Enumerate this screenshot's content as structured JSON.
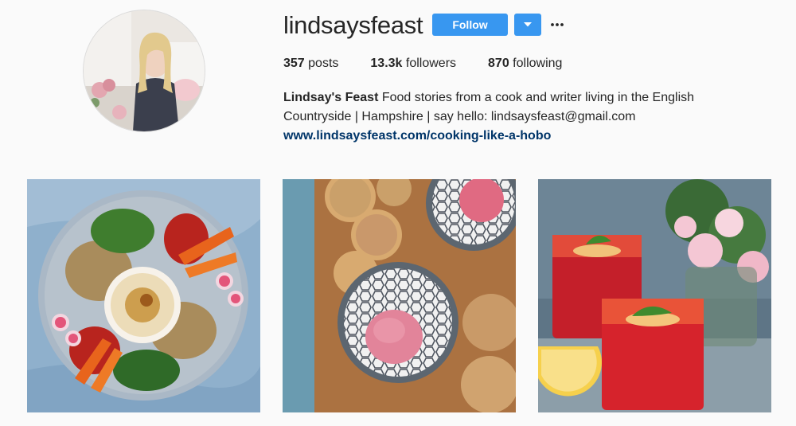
{
  "profile": {
    "username": "lindsaysfeast",
    "follow_label": "Follow",
    "dropdown_icon": "chevron-down-icon",
    "more_icon": "ellipsis-icon",
    "stats": {
      "posts_count": "357",
      "posts_label": " posts",
      "followers_count": "13.3k",
      "followers_label": " followers",
      "following_count": "870",
      "following_label": " following"
    },
    "bio": {
      "full_name": "Lindsay's Feast",
      "text_line1": " Food stories from a cook and writer living in the English",
      "text_line2": "Countryside | Hampshire | say hello: lindsaysfeast@gmail.com",
      "link": "www.lindsaysfeast.com/cooking-like-a-hobo"
    }
  },
  "posts": [
    {
      "subject": "mezze platter with hummus, carrots, radishes and salads"
    },
    {
      "subject": "biscuits and pink ice cream in patterned bowls"
    },
    {
      "subject": "red drinks with basil and lemon, pink flowers"
    }
  ],
  "colors": {
    "accent": "#3897f0",
    "link": "#003569",
    "background": "#fafafa",
    "text": "#262626"
  }
}
